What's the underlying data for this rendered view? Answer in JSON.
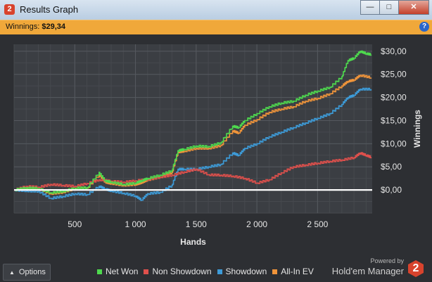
{
  "window": {
    "title": "Results Graph",
    "app_logo_text": "2",
    "buttons": {
      "minimize": "—",
      "maximize": "□",
      "close": "✕"
    }
  },
  "winbar": {
    "label": "Winnings:",
    "value": "$29,34",
    "help": "?"
  },
  "chart_data": {
    "type": "line",
    "xlabel": "Hands",
    "ylabel": "Winnings",
    "xlim": [
      0,
      2950
    ],
    "ylim": [
      -5,
      31.5
    ],
    "x_ticks": [
      500,
      1000,
      1500,
      2000,
      2500
    ],
    "x_tick_labels": [
      "500",
      "1 000",
      "1 500",
      "2 000",
      "2 500"
    ],
    "y_ticks": [
      0,
      5,
      10,
      15,
      20,
      25,
      30
    ],
    "y_tick_labels": [
      "$0,00",
      "$5,00",
      "$10,00",
      "$15,00",
      "$20,00",
      "$25,00",
      "$30,00"
    ],
    "grid": true,
    "legend_position": "bottom",
    "series": [
      {
        "name": "Net Won",
        "color": "#4ed94e",
        "x": [
          0,
          100,
          200,
          300,
          400,
          500,
          600,
          700,
          750,
          800,
          900,
          1000,
          1050,
          1100,
          1200,
          1300,
          1350,
          1400,
          1500,
          1600,
          1700,
          1800,
          1850,
          1900,
          2000,
          2100,
          2200,
          2300,
          2400,
          2500,
          2600,
          2700,
          2750,
          2800,
          2850,
          2900,
          2940
        ],
        "y": [
          0,
          0.5,
          0.3,
          -0.6,
          -0.3,
          0.4,
          0.5,
          3.8,
          2.0,
          1.7,
          1.2,
          1.5,
          2.0,
          2.5,
          3.2,
          4.2,
          8.5,
          8.8,
          9.5,
          9.4,
          10.2,
          13.8,
          13.5,
          15.0,
          16.5,
          18.0,
          18.8,
          19.2,
          20.5,
          21.4,
          22.2,
          24.5,
          28.0,
          28.5,
          30.0,
          29.5,
          29.3
        ]
      },
      {
        "name": "Non Showdown",
        "color": "#e0504c",
        "x": [
          0,
          100,
          200,
          300,
          400,
          500,
          600,
          700,
          800,
          900,
          1000,
          1100,
          1200,
          1300,
          1400,
          1500,
          1600,
          1700,
          1800,
          1900,
          2000,
          2100,
          2200,
          2300,
          2400,
          2500,
          2600,
          2700,
          2800,
          2850,
          2900,
          2940
        ],
        "y": [
          0,
          0.8,
          0.6,
          1.2,
          1.0,
          0.8,
          1.4,
          2.2,
          1.9,
          1.7,
          2.0,
          2.3,
          2.8,
          3.2,
          3.9,
          4.5,
          3.3,
          3.2,
          3.0,
          2.5,
          1.5,
          2.2,
          3.7,
          5.0,
          5.4,
          5.8,
          6.2,
          6.5,
          7.0,
          8.0,
          7.5,
          7.1
        ]
      },
      {
        "name": "Showdown",
        "color": "#3d9bd8",
        "x": [
          0,
          100,
          200,
          300,
          400,
          500,
          600,
          700,
          750,
          800,
          900,
          1000,
          1050,
          1100,
          1200,
          1300,
          1350,
          1400,
          1500,
          1600,
          1700,
          1800,
          1850,
          1900,
          2000,
          2100,
          2200,
          2300,
          2400,
          2500,
          2600,
          2700,
          2750,
          2800,
          2850,
          2940
        ],
        "y": [
          0,
          -0.2,
          -0.3,
          -1.8,
          -1.4,
          -0.8,
          -1.0,
          0.8,
          0.2,
          -0.2,
          -0.7,
          -1.3,
          -2.2,
          -0.8,
          -0.5,
          1.0,
          4.5,
          4.5,
          4.5,
          5.0,
          5.5,
          8.0,
          7.5,
          9.0,
          10.0,
          11.5,
          12.5,
          13.5,
          14.5,
          15.5,
          16.5,
          18.5,
          20.0,
          20.5,
          21.8,
          21.8
        ]
      },
      {
        "name": "All-In EV",
        "color": "#f0943a",
        "x": [
          0,
          100,
          200,
          300,
          400,
          500,
          600,
          700,
          750,
          800,
          900,
          1000,
          1050,
          1100,
          1200,
          1300,
          1350,
          1400,
          1500,
          1600,
          1700,
          1800,
          1850,
          1900,
          2000,
          2100,
          2200,
          2300,
          2400,
          2500,
          2600,
          2700,
          2750,
          2800,
          2850,
          2940
        ],
        "y": [
          0,
          0.3,
          0.2,
          -0.8,
          -0.5,
          0.3,
          0.4,
          3.3,
          1.7,
          1.4,
          1.0,
          1.2,
          1.6,
          2.2,
          2.8,
          3.8,
          8.2,
          8.4,
          9.0,
          9.0,
          9.6,
          12.8,
          12.3,
          14.0,
          15.2,
          16.8,
          17.5,
          18.0,
          19.2,
          19.8,
          20.8,
          22.5,
          23.5,
          23.8,
          24.8,
          24.3
        ]
      }
    ],
    "baseline_color": "#ffffff"
  },
  "footer": {
    "options_label": "Options",
    "powered": "Powered by",
    "brand": "Hold'em Manager",
    "brand_logo": "2"
  }
}
